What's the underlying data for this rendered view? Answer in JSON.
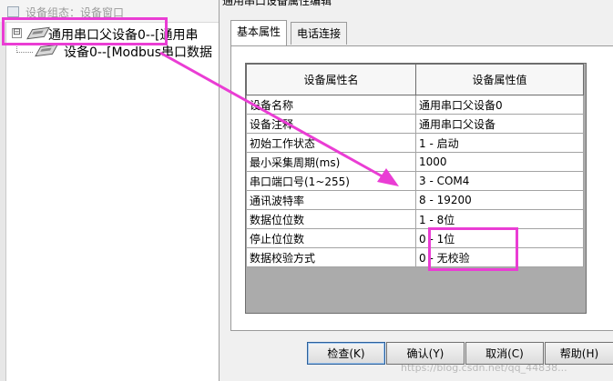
{
  "tree_window": {
    "title": "设备组态：设备窗口",
    "root_node": {
      "expander": "⊟",
      "label": "通用串口父设备0--[通用串"
    },
    "child_node": {
      "label": "设备0--[Modbus串口数据"
    }
  },
  "dialog": {
    "title": "通用串口设备属性编辑",
    "tabs": [
      "基本属性",
      "电话连接"
    ],
    "table": {
      "headers": [
        "设备属性名",
        "设备属性值"
      ],
      "rows": [
        [
          "设备名称",
          "通用串口父设备0"
        ],
        [
          "设备注释",
          "通用串口父设备"
        ],
        [
          "初始工作状态",
          "1 - 启动"
        ],
        [
          "最小采集周期(ms)",
          "1000"
        ],
        [
          "串口端口号(1~255)",
          "3 - COM4"
        ],
        [
          "通讯波特率",
          "8 - 19200"
        ],
        [
          "数据位位数",
          "1 - 8位"
        ],
        [
          "停止位位数",
          "0 - 1位"
        ],
        [
          "数据校验方式",
          "0 - 无校验"
        ]
      ]
    },
    "buttons": {
      "check": "检查(K)",
      "ok": "确认(Y)",
      "cancel": "取消(C)",
      "help": "帮助(H)"
    }
  },
  "watermark": "https://blog.csdn.net/qq_44838...",
  "colors": {
    "callout": "#ea3dd4"
  }
}
